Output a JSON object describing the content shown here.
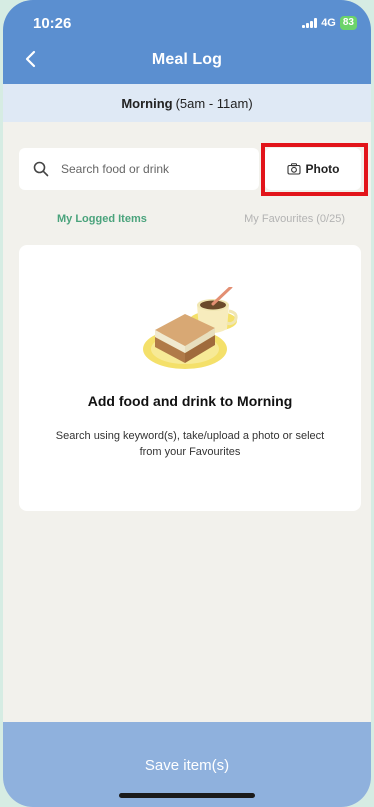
{
  "status": {
    "time": "10:26",
    "network": "4G",
    "battery": "83"
  },
  "header": {
    "title": "Meal Log"
  },
  "period": {
    "name": "Morning",
    "range": "(5am - 11am)"
  },
  "search": {
    "placeholder": "Search food or drink",
    "photo_label": "Photo"
  },
  "tabs": [
    {
      "label": "My Logged Items",
      "active": true
    },
    {
      "label": "My Favourites (0/25)",
      "active": false
    }
  ],
  "empty": {
    "title": "Add food and drink to Morning",
    "description": "Search using keyword(s), take/upload a photo or select from your Favourites"
  },
  "footer": {
    "save_label": "Save item(s)"
  },
  "colors": {
    "header": "#5b8fd0",
    "accent": "#4aa37c",
    "highlight": "#e2141a",
    "save_button": "#8fb1dd"
  }
}
